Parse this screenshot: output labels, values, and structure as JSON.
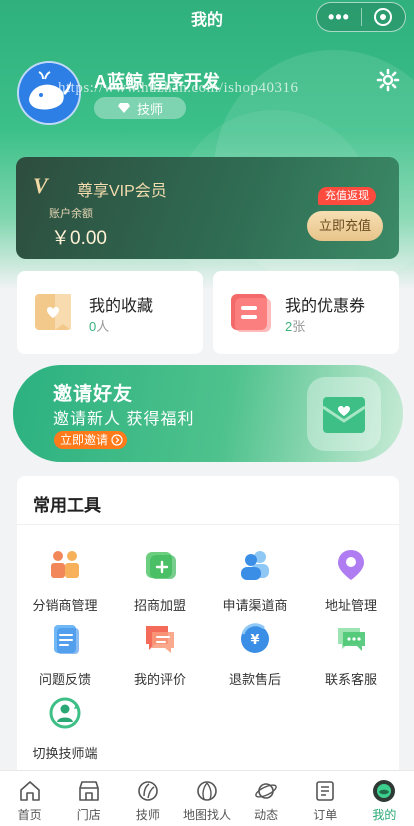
{
  "nav": {
    "title": "我的"
  },
  "user": {
    "name": "A蓝鲸 程序开发",
    "role": "技师",
    "watermark": "https://www.huzhan.com/ishop40316"
  },
  "vip": {
    "title": "尊享VIP会员",
    "balance_label": "账户余额",
    "balance": "￥0.00",
    "promo_tag": "充值返现",
    "recharge_button": "立即充值"
  },
  "favorites": {
    "label": "我的收藏",
    "count": "0",
    "unit": "人"
  },
  "coupons": {
    "label": "我的优惠券",
    "count": "2",
    "unit": "张"
  },
  "invite": {
    "title": "邀请好友",
    "subtitle": "邀请新人 获得福利",
    "button": "立即邀请"
  },
  "tools": {
    "title": "常用工具",
    "items": [
      {
        "label": "分销商管理",
        "icon": "distributor-icon"
      },
      {
        "label": "招商加盟",
        "icon": "franchise-icon"
      },
      {
        "label": "申请渠道商",
        "icon": "channel-icon"
      },
      {
        "label": "地址管理",
        "icon": "location-icon"
      },
      {
        "label": "问题反馈",
        "icon": "feedback-icon"
      },
      {
        "label": "我的评价",
        "icon": "review-icon"
      },
      {
        "label": "退款售后",
        "icon": "refund-icon"
      },
      {
        "label": "联系客服",
        "icon": "chat-icon"
      },
      {
        "label": "切换技师端",
        "icon": "switch-icon"
      }
    ]
  },
  "tabbar": {
    "items": [
      {
        "label": "首页",
        "icon": "home-icon"
      },
      {
        "label": "门店",
        "icon": "store-icon"
      },
      {
        "label": "技师",
        "icon": "technician-icon"
      },
      {
        "label": "地图找人",
        "icon": "map-icon"
      },
      {
        "label": "动态",
        "icon": "planet-icon"
      },
      {
        "label": "订单",
        "icon": "order-icon"
      },
      {
        "label": "我的",
        "icon": "profile-icon",
        "active": true
      }
    ]
  },
  "colors": {
    "primary": "#2fb07d",
    "accent": "#ff7a1a",
    "vip_gold": "#f3dcae"
  }
}
